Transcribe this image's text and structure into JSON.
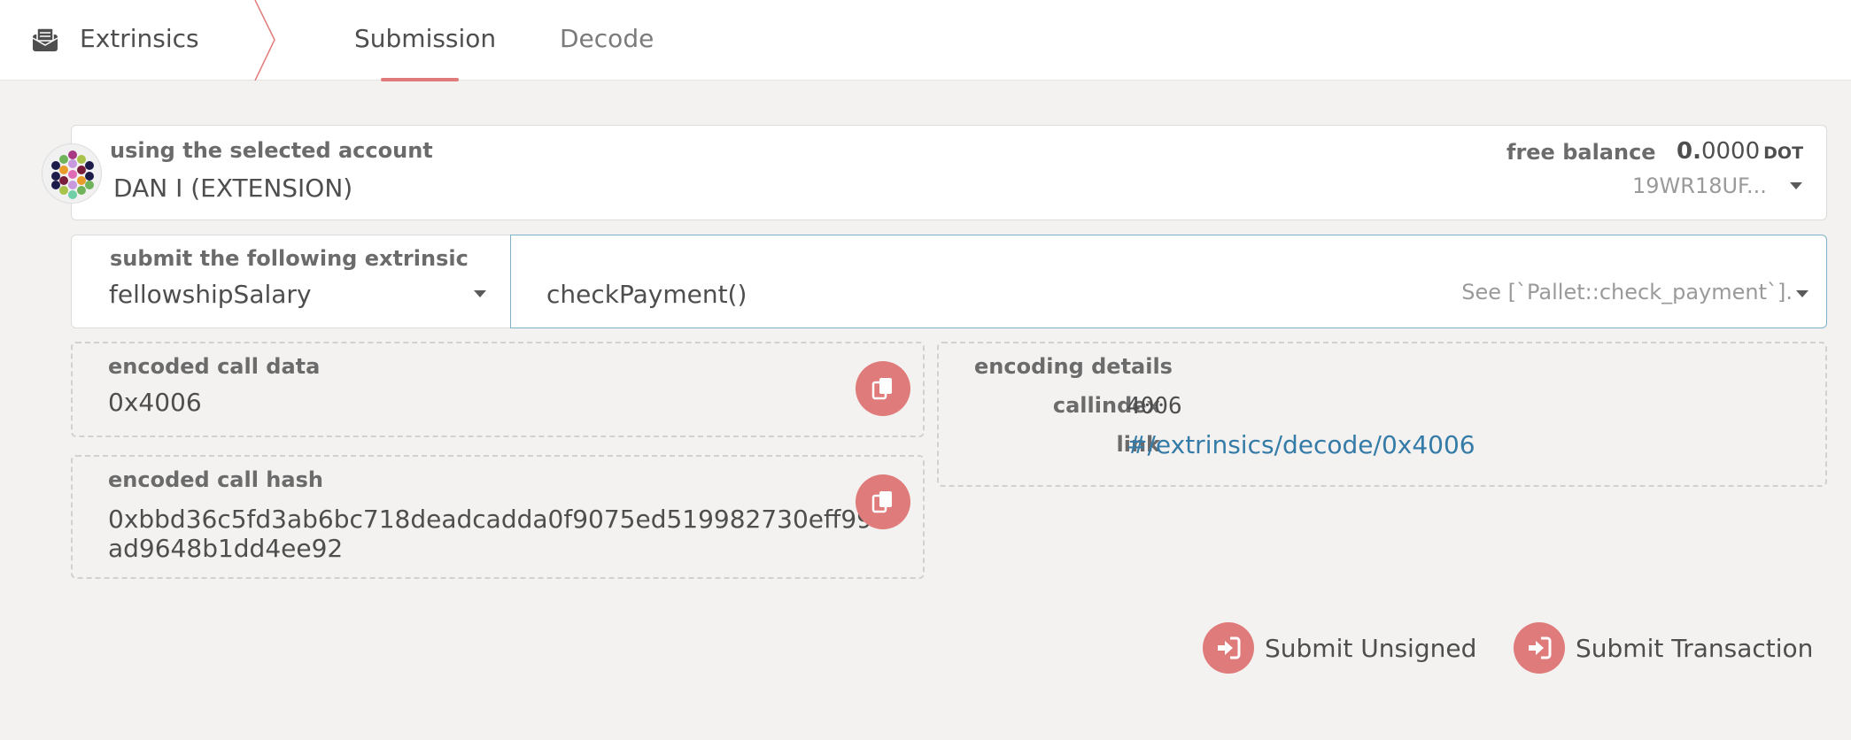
{
  "header": {
    "app_title": "Extrinsics",
    "app_icon": "envelope-icon",
    "tabs": [
      {
        "label": "Submission",
        "active": true
      },
      {
        "label": "Decode",
        "active": false
      }
    ]
  },
  "account": {
    "label": "using the selected account",
    "value": "DAN I (EXTENSION)",
    "balance_label": "free balance",
    "balance_int": "0.",
    "balance_dec": "0000",
    "balance_unit": "DOT",
    "address": "19WR18UF..."
  },
  "extrinsic": {
    "label": "submit the following extrinsic",
    "pallet": "fellowshipSalary",
    "method": "checkPayment()",
    "description": "See [`Pallet::check_payment`]."
  },
  "encoded_call_data": {
    "label": "encoded call data",
    "value": "0x4006"
  },
  "encoded_call_hash": {
    "label": "encoded call hash",
    "value": "0xbbd36c5fd3ab6bc718deadcadda0f9075ed519982730eff99ad9648b1dd4ee92"
  },
  "encoding_details": {
    "label": "encoding details",
    "callindex_label": "callindex",
    "callindex_value": "4006",
    "link_label": "link",
    "link_value": "#/extrinsics/decode/0x4006"
  },
  "actions": {
    "submit_unsigned": "Submit Unsigned",
    "submit_transaction": "Submit Transaction"
  },
  "colors": {
    "accent": "#e07b7b",
    "link": "#357ba8",
    "background": "#f3f2f0"
  }
}
